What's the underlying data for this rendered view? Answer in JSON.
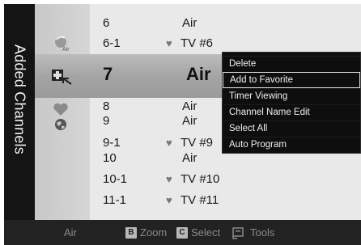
{
  "screen": {
    "title": "Added Channels"
  },
  "channels": [
    {
      "number": "6",
      "name": "Air",
      "favorite": false
    },
    {
      "number": "6-1",
      "name": "TV #6",
      "favorite": true
    },
    {
      "number": "7",
      "name": "Air",
      "favorite": false,
      "selected": true
    },
    {
      "number": "8",
      "name": "Air",
      "favorite": false
    },
    {
      "number": "9",
      "name": "Air",
      "favorite": false
    },
    {
      "number": "9-1",
      "name": "TV #9",
      "favorite": true
    },
    {
      "number": "10",
      "name": "Air",
      "favorite": false
    },
    {
      "number": "10-1",
      "name": "TV #10",
      "favorite": true
    },
    {
      "number": "11-1",
      "name": "TV #11",
      "favorite": true
    }
  ],
  "heart_glyph": "♥",
  "row_icons": {
    "air_badge": "Air",
    "air_icon": "satellite-dish-icon",
    "selected_icon": "add-channel-icon",
    "favorite_icon": "heart-icon",
    "lock_icon": "globe-icon"
  },
  "tools_menu": {
    "items": [
      "Delete",
      "Add to Favorite",
      "Timer Viewing",
      "Channel Name Edit",
      "Select All",
      "Auto Program"
    ],
    "selected_index": 1
  },
  "bottom_bar": {
    "antenna": "Air",
    "zoom_key": "B",
    "zoom_label": "Zoom",
    "select_key": "C",
    "select_label": "Select",
    "tools_label": "Tools"
  },
  "colors": {
    "title_band": "#141414",
    "list_background": "#e9e9e9",
    "selection_band": "#a5a5a5",
    "menu_background": "#0e0e0e",
    "heart": "#777777"
  }
}
